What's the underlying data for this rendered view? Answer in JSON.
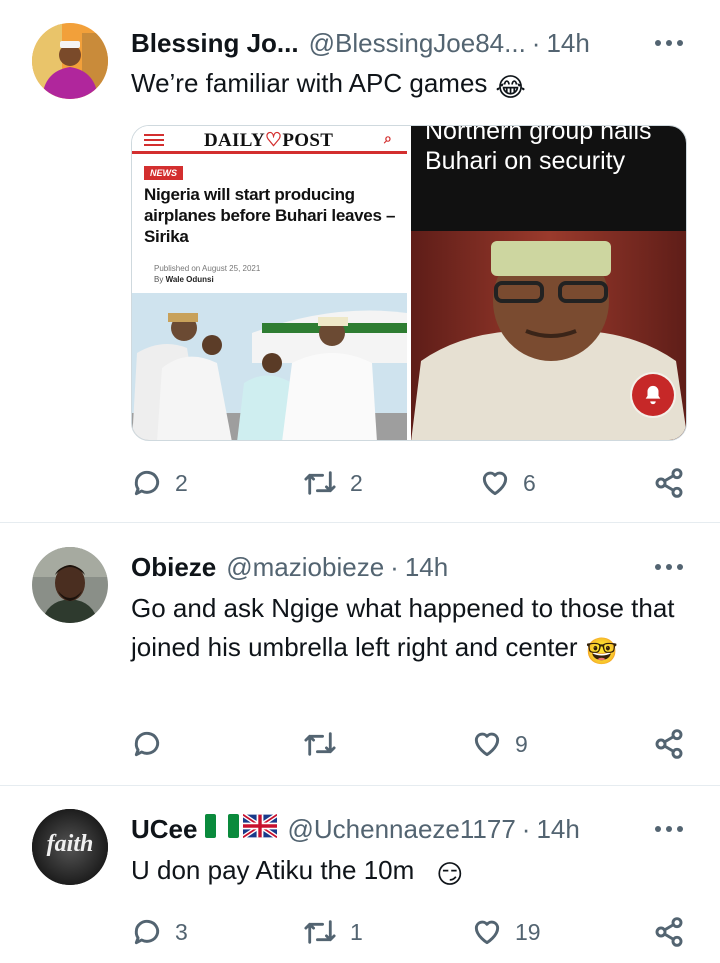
{
  "tweets": [
    {
      "name": "Blessing Jo...",
      "handle": "@BlessingJoe84...",
      "time": "14h",
      "text": "We’re familiar with APC games",
      "emoji": "😂",
      "media": {
        "left": {
          "logo_left": "DAILY",
          "logo_right": "POST",
          "badge": "NEWS",
          "headline": "Nigeria will start producing airplanes before Buhari leaves – Sirika",
          "published": "Published on August 25, 2021",
          "by_prefix": "By",
          "author": "Wale Odunsi"
        },
        "right": {
          "headline": "Northern group hails Buhari on security"
        }
      },
      "replies": "2",
      "retweets": "2",
      "likes": "6"
    },
    {
      "name": "Obieze",
      "handle": "@maziobieze",
      "time": "14h",
      "text": "Go and ask Ngige what happened to those that joined his umbrella left right and center",
      "emoji": "🤓",
      "replies": "",
      "retweets": "",
      "likes": "9"
    },
    {
      "name": "UCee",
      "flags": "🇳🇬🇬🇧",
      "handle": "@Uchennaeze1177",
      "time": "14h",
      "text": "U don pay Atiku the 10m",
      "emoji": "😏",
      "avatar_text": "faith",
      "replies": "3",
      "retweets": "1",
      "likes": "19"
    }
  ],
  "colors": {
    "text": "#0f1419",
    "secondary": "#536471",
    "divider": "#e6ecf0",
    "dailypost_red": "#d32f2f"
  },
  "icons": [
    "reply-icon",
    "retweet-icon",
    "like-icon",
    "share-icon",
    "more-icon",
    "notification-bell-icon"
  ]
}
